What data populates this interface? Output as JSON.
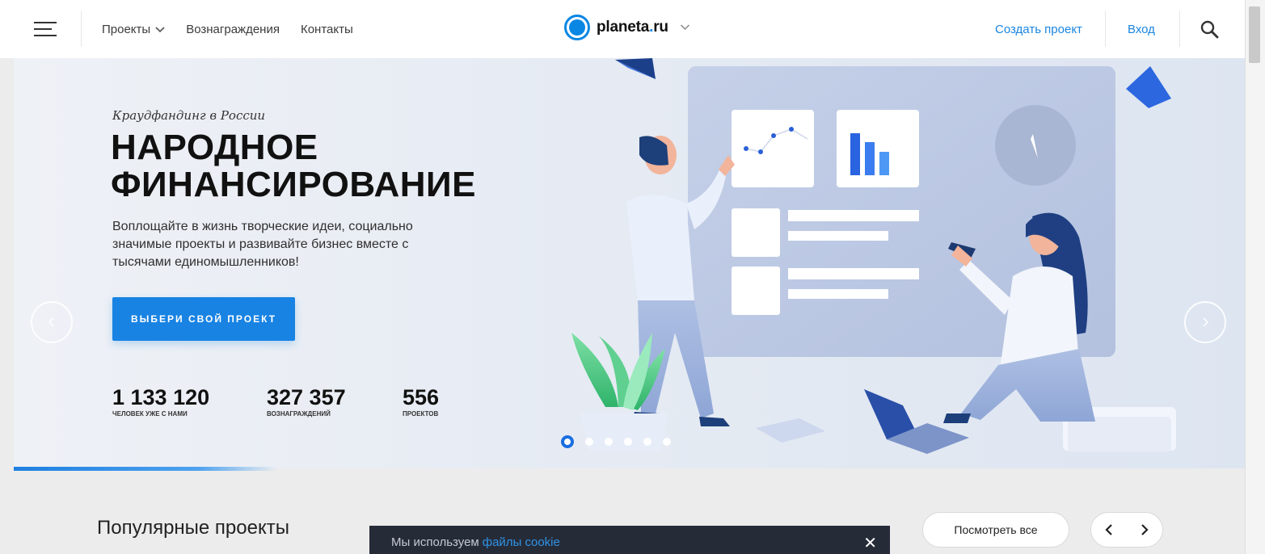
{
  "header": {
    "nav": [
      {
        "label": "Проекты",
        "has_dropdown": true
      },
      {
        "label": "Вознаграждения",
        "has_dropdown": false
      },
      {
        "label": "Контакты",
        "has_dropdown": false
      }
    ],
    "logo_text_main": "planeta",
    "logo_text_dot": ".",
    "logo_text_tld": "ru",
    "create_project": "Создать проект",
    "login": "Вход",
    "icons": {
      "menu": "hamburger-menu-icon",
      "search": "search-icon",
      "dropdown": "chevron-down-icon"
    }
  },
  "hero": {
    "eyebrow": "Краудфандинг в России",
    "title_line1": "НАРОДНОЕ",
    "title_line2": "ФИНАНСИРОВАНИЕ",
    "description": "Воплощайте в жизнь творческие идеи, социально значимые проекты и развивайте бизнес вместе с тысячами единомышленников!",
    "cta": "ВЫБЕРИ СВОЙ ПРОЕКТ",
    "stats": [
      {
        "value": "1 133 120",
        "label": "ЧЕЛОВЕК УЖЕ С НАМИ"
      },
      {
        "value": "327 357",
        "label": "ВОЗНАГРАЖДЕНИЙ"
      },
      {
        "value": "556",
        "label": "ПРОЕКТОВ"
      }
    ],
    "slides_count": 6,
    "active_slide": 1
  },
  "popular": {
    "title": "Популярные проекты",
    "see_all": "Посмотреть все"
  },
  "cookie": {
    "text": "Мы используем",
    "link": "файлы cookie"
  },
  "colors": {
    "accent": "#1883e3",
    "link": "#1a85de",
    "cookie_bg": "#262b38",
    "hero_bg": "#e6ebf3"
  }
}
